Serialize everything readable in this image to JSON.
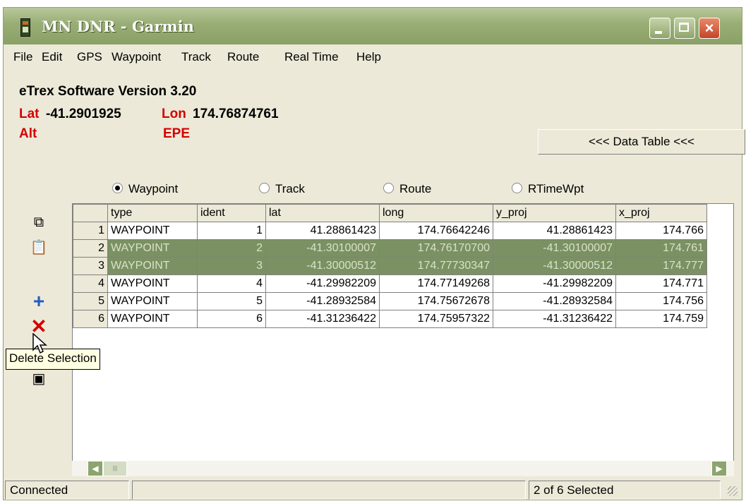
{
  "window": {
    "title": "MN DNR - Garmin"
  },
  "menu": [
    "File",
    "Edit",
    "GPS",
    "Waypoint",
    "Track",
    "Route",
    "Real Time",
    "Help"
  ],
  "info": {
    "software": "eTrex Software Version 3.20",
    "lat_label": "Lat",
    "lat_value": "-41.2901925",
    "lon_label": "Lon",
    "lon_value": "174.76874761",
    "alt_label": "Alt",
    "epe_label": "EPE"
  },
  "data_table_button": "<<< Data Table <<<",
  "radios": [
    {
      "label": "Waypoint",
      "checked": true
    },
    {
      "label": "Track",
      "checked": false
    },
    {
      "label": "Route",
      "checked": false
    },
    {
      "label": "RTimeWpt",
      "checked": false
    }
  ],
  "table": {
    "columns": [
      "type",
      "ident",
      "lat",
      "long",
      "y_proj",
      "x_proj"
    ],
    "rows": [
      {
        "n": "1",
        "type": "WAYPOINT",
        "ident": "1",
        "lat": "41.28861423",
        "long": "174.76642246",
        "y_proj": "41.28861423",
        "x_proj": "174.766",
        "selected": false
      },
      {
        "n": "2",
        "type": "WAYPOINT",
        "ident": "2",
        "lat": "-41.30100007",
        "long": "174.76170700",
        "y_proj": "-41.30100007",
        "x_proj": "174.761",
        "selected": true
      },
      {
        "n": "3",
        "type": "WAYPOINT",
        "ident": "3",
        "lat": "-41.30000512",
        "long": "174.77730347",
        "y_proj": "-41.30000512",
        "x_proj": "174.777",
        "selected": true
      },
      {
        "n": "4",
        "type": "WAYPOINT",
        "ident": "4",
        "lat": "-41.29982209",
        "long": "174.77149268",
        "y_proj": "-41.29982209",
        "x_proj": "174.771",
        "selected": false
      },
      {
        "n": "5",
        "type": "WAYPOINT",
        "ident": "5",
        "lat": "-41.28932584",
        "long": "174.75672678",
        "y_proj": "-41.28932584",
        "x_proj": "174.756",
        "selected": false
      },
      {
        "n": "6",
        "type": "WAYPOINT",
        "ident": "6",
        "lat": "-41.31236422",
        "long": "174.75957322",
        "y_proj": "-41.31236422",
        "x_proj": "174.759",
        "selected": false
      }
    ]
  },
  "tooltip": "Delete Selection",
  "status": {
    "connection": "Connected",
    "selection": "2 of 6 Selected"
  },
  "colors": {
    "selected_row": "#7b9163",
    "accent_red": "#d40000",
    "titlebar": "#98ad74"
  },
  "icons": [
    "copy-icon",
    "paste-icon",
    "add-icon",
    "delete-icon",
    "save-icon"
  ]
}
